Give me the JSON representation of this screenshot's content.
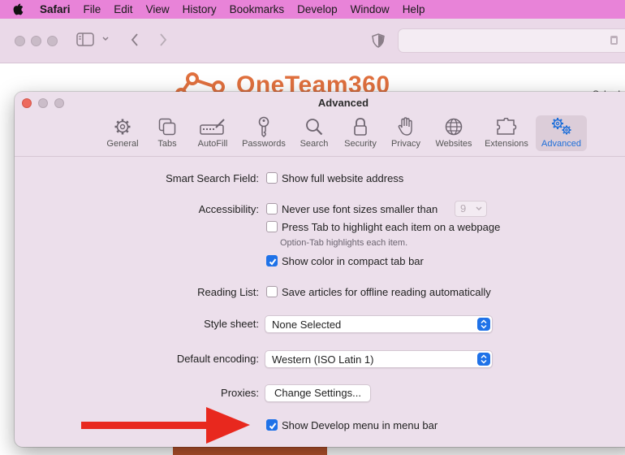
{
  "menubar": {
    "app": "Safari",
    "items": [
      "File",
      "Edit",
      "View",
      "History",
      "Bookmarks",
      "Develop",
      "Window",
      "Help"
    ]
  },
  "webpage": {
    "logo_text": "OneTeam360",
    "corner_text": "Sched"
  },
  "prefs": {
    "title": "Advanced",
    "tabs": [
      {
        "label": "General",
        "icon": "gear-icon"
      },
      {
        "label": "Tabs",
        "icon": "tabs-icon"
      },
      {
        "label": "AutoFill",
        "icon": "autofill-icon"
      },
      {
        "label": "Passwords",
        "icon": "key-icon"
      },
      {
        "label": "Search",
        "icon": "search-icon"
      },
      {
        "label": "Security",
        "icon": "lock-icon"
      },
      {
        "label": "Privacy",
        "icon": "hand-icon"
      },
      {
        "label": "Websites",
        "icon": "globe-icon"
      },
      {
        "label": "Extensions",
        "icon": "puzzle-icon"
      },
      {
        "label": "Advanced",
        "icon": "gears-icon"
      }
    ],
    "active_tab": "Advanced",
    "smart_search": {
      "label": "Smart Search Field:",
      "option": "Show full website address",
      "checked": false
    },
    "accessibility": {
      "label": "Accessibility:",
      "font_size_option": "Never use font sizes smaller than",
      "font_size_value": "9",
      "font_size_checked": false,
      "tab_option": "Press Tab to highlight each item on a webpage",
      "tab_checked": false,
      "tab_hint": "Option-Tab highlights each item.",
      "color_option": "Show color in compact tab bar",
      "color_checked": true
    },
    "reading_list": {
      "label": "Reading List:",
      "option": "Save articles for offline reading automatically",
      "checked": false
    },
    "style_sheet": {
      "label": "Style sheet:",
      "value": "None Selected"
    },
    "encoding": {
      "label": "Default encoding:",
      "value": "Western (ISO Latin 1)"
    },
    "proxies": {
      "label": "Proxies:",
      "button": "Change Settings..."
    },
    "develop": {
      "option": "Show Develop menu in menu bar",
      "checked": true
    }
  },
  "colors": {
    "menubar": "#e883d8",
    "toolbar": "#ead9e8",
    "window": "#ecdfeb",
    "accent": "#1f72e8",
    "arrow": "#e8281e",
    "logo": "#e0703e"
  }
}
